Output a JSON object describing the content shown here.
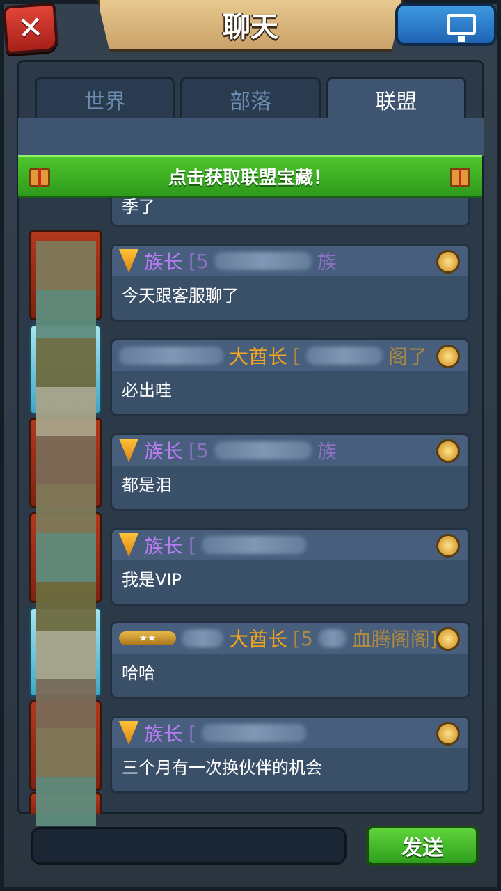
{
  "header": {
    "title": "聊天"
  },
  "tabs": [
    {
      "label": "世界"
    },
    {
      "label": "部落"
    },
    {
      "label": "联盟"
    }
  ],
  "banner": {
    "text": "点击获取联盟宝藏！"
  },
  "messages": [
    {
      "rank_icon": "shield-icon",
      "role": "",
      "text": "季了",
      "avatar": "fire",
      "partial": true
    },
    {
      "rank_icon": "shield-icon",
      "role": "族长",
      "name_visible": "[5",
      "name_suffix": "族",
      "text": "今天跟客服聊了",
      "avatar": "fire"
    },
    {
      "rank_icon": "",
      "role": "大酋长",
      "name_visible": "[",
      "name_suffix": "阁了",
      "text": "必出哇",
      "avatar": "ice"
    },
    {
      "rank_icon": "shield-icon",
      "role": "族长",
      "name_visible": "[5",
      "name_suffix": "族",
      "text": "都是泪",
      "avatar": "fire"
    },
    {
      "rank_icon": "shield-icon",
      "role": "族长",
      "name_visible": "[",
      "name_suffix": "",
      "text": "我是VIP",
      "avatar": "fire"
    },
    {
      "rank_icon": "stars-icon",
      "stars": "★★",
      "role": "大酋长",
      "name_visible": "[5",
      "name_suffix": "血腾阁阁]",
      "text": "哈哈",
      "avatar": "ice"
    },
    {
      "rank_icon": "shield-icon",
      "role": "族长",
      "name_visible": "[",
      "name_suffix": "",
      "text": "三个月有一次换伙伴的机会",
      "avatar": "fire"
    }
  ],
  "footer": {
    "send_label": "发送"
  }
}
